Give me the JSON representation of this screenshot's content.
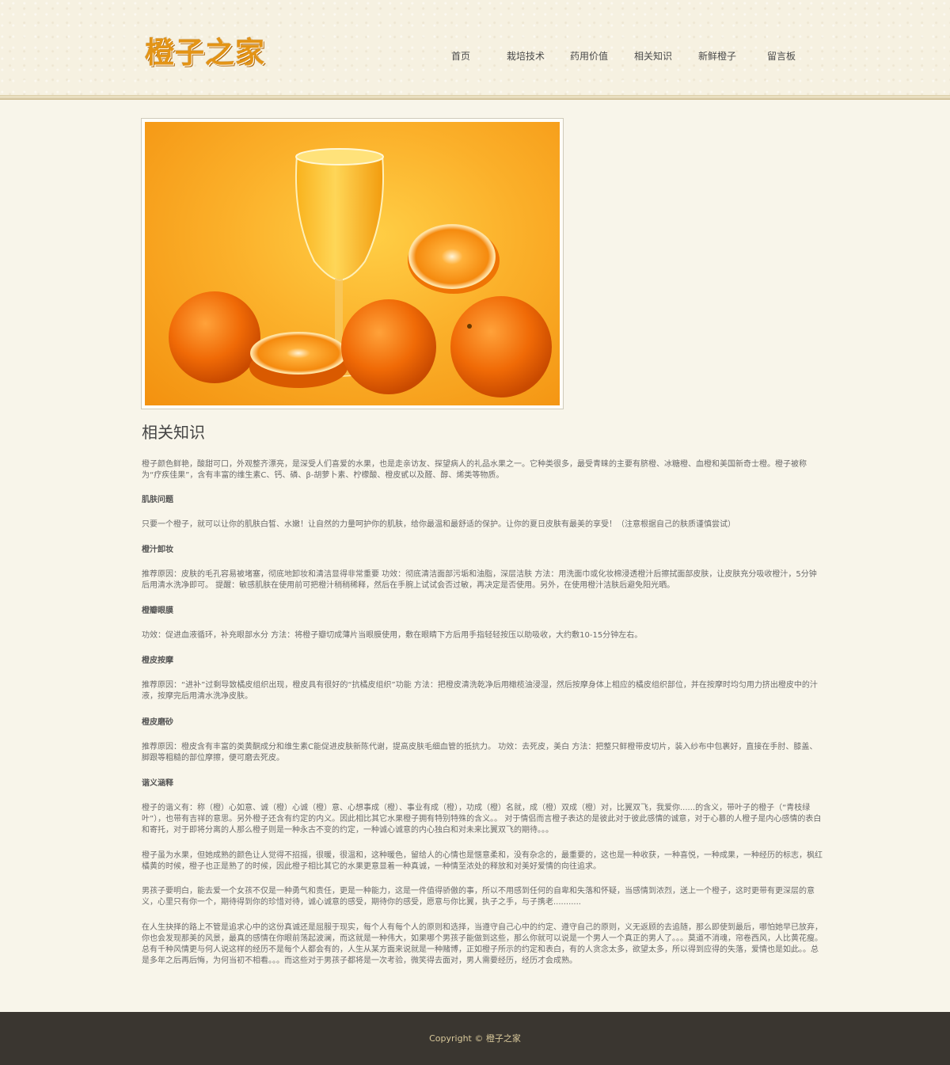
{
  "header": {
    "logo_text": "橙子之家",
    "nav": [
      "首页",
      "栽培技术",
      "药用价值",
      "相关知识",
      "新鲜橙子",
      "留言板"
    ]
  },
  "main": {
    "section_title": "相关知识",
    "paragraphs": [
      {
        "type": "text",
        "text": "橙子颜色鲜艳，酸甜可口，外观整齐漂亮，是深受人们喜爱的水果，也是走亲访友、探望病人的礼品水果之一。它种类很多，最受青睐的主要有脐橙、冰糖橙、血橙和美国新奇士橙。橙子被称为“疗疾佳果”，含有丰富的维生素C、钙、磷、β-胡萝卜素、柠檬酸、橙皮甙以及醛、醇、烯类等物质。"
      },
      {
        "type": "heading",
        "text": "肌肤问题"
      },
      {
        "type": "text",
        "text": "只要一个橙子，就可以让你的肌肤白皙、水嫩！让自然的力量呵护你的肌肤，给你最温和最舒适的保护。让你的夏日皮肤有最美的享受！（注意根据自己的肤质谨慎尝试）"
      },
      {
        "type": "heading",
        "text": "橙汁卸妆"
      },
      {
        "type": "text",
        "text": "推荐原因：皮肤的毛孔容易被堵塞，彻底地卸妆和清洁显得非常重要 功效：彻底清洁面部污垢和油脂，深层洁肤 方法：用洗面巾或化妆棉浸透橙汁后擦拭面部皮肤，让皮肤充分吸收橙汁，5分钟后用清水洗净即可。 提醒：敏感肌肤在使用前可把橙汁稍稍稀释，然后在手腕上试试会否过敏，再决定是否使用。另外，在使用橙汁洁肤后避免阳光晒。"
      },
      {
        "type": "heading",
        "text": "橙瓣眼膜"
      },
      {
        "type": "text",
        "text": "功效：促进血液循环，补充眼部水分 方法：将橙子瓣切成薄片当眼膜使用，敷在眼睛下方后用手指轻轻按压以助吸收，大约敷10-15分钟左右。"
      },
      {
        "type": "heading",
        "text": "橙皮按摩"
      },
      {
        "type": "text",
        "text": "推荐原因：“进补”过剩导致橘皮组织出现，橙皮具有很好的“抗橘皮组织”功能 方法：把橙皮清洗乾净后用橄榄油浸湿，然后按摩身体上相应的橘皮组织部位，并在按摩时均匀用力挤出橙皮中的汁液，按摩完后用清水洗净皮肤。"
      },
      {
        "type": "heading",
        "text": "橙皮磨砂"
      },
      {
        "type": "text",
        "text": "推荐原因：橙皮含有丰富的类黄酮成分和维生素C能促进皮肤新陈代谢，提高皮肤毛细血管的抵抗力。 功效：去死皮，美白 方法：把整只鲜橙带皮切片，装入纱布中包裹好，直接在手肘、膝盖、脚跟等粗糙的部位摩擦，便可磨去死皮。"
      },
      {
        "type": "heading",
        "text": "谐义涵释"
      },
      {
        "type": "text",
        "text": "橙子的谐义有：称（橙）心如意、诚（橙）心诚（橙）意、心想事成（橙）、事业有成（橙），功成（橙）名就，成（橙）双成（橙）对，比翼双飞，我爱你......的含义，带叶子的橙子（“青枝绿叶”），也带有吉祥的意思。另外橙子还含有约定的内义。因此相比其它水果橙子拥有特别特殊的含义。。 对于情侣而言橙子表达的是彼此对于彼此感情的诚意，对于心慕的人橙子是内心感情的表白和寄托，对于即将分离的人那么橙子则是一种永古不变的约定，一种诚心诚意的内心独白和对未来比翼双飞的期待。。。"
      },
      {
        "type": "text",
        "text": "橙子虽为水果，但她成熟的颜色让人觉得不招摇，很暖，很温和，这种暖色，留给人的心情也是惬意柔和，没有杂念的，最重要的，这也是一种收获，一种喜悦，一种成果，一种经历的标志，枫红橘黄的时候，橙子也正是熟了的时候，因此橙子相比其它的水果更意显着一种真诚，一种情至浓处的释放和对美好爱情的向往追求。"
      },
      {
        "type": "text",
        "text": "男孩子要明白，能去爱一个女孩不仅是一种勇气和责任，更是一种能力，这是一件值得骄傲的事，所以不用感到任何的自卑和失落和怀疑，当感情到浓烈，送上一个橙子，这时更带有更深层的意义，心里只有你一个，期待得到你的珍惜对待，诚心诚意的感受，期待你的感受，愿意与你比翼，执子之手，与子携老..........."
      },
      {
        "type": "text",
        "text": "在人生抉择的路上不管是追求心中的这份真诚还是屈服于现实，每个人有每个人的原则和选择，当遵守自己心中的约定、遵守自己的原则，义无返顾的去追随，那么即使到最后，哪怕她早已放弃，你也会发现那美的风景，最真的感情在你眼前荡起波澜，而这就是一种伟大，如果哪个男孩子能做到这些，那么你就可以说是一个男人一个真正的男人了。。。莫道不消魂，帘卷西风，人比黄花瘦。总有千种风情更与何人说这样的经历不是每个人都会有的，人生从某方面来说就是一种赌博，正如橙子所示的约定和表白，有的人贪念太多，欲望太多，所以得到应得的失落，爱情也是如此。。总是多年之后再后悔，为何当初不相看。。。而这些对于男孩子都将是一次考验，微笑得去面对，男人需要经历，经历才会成熟。"
      }
    ]
  },
  "footer": {
    "copyright": "Copyright © 橙子之家"
  },
  "colors": {
    "background": "#f8f5ea",
    "logo": "#e39416",
    "footer_bg": "#3a3630",
    "footer_text": "#d8c89a"
  }
}
